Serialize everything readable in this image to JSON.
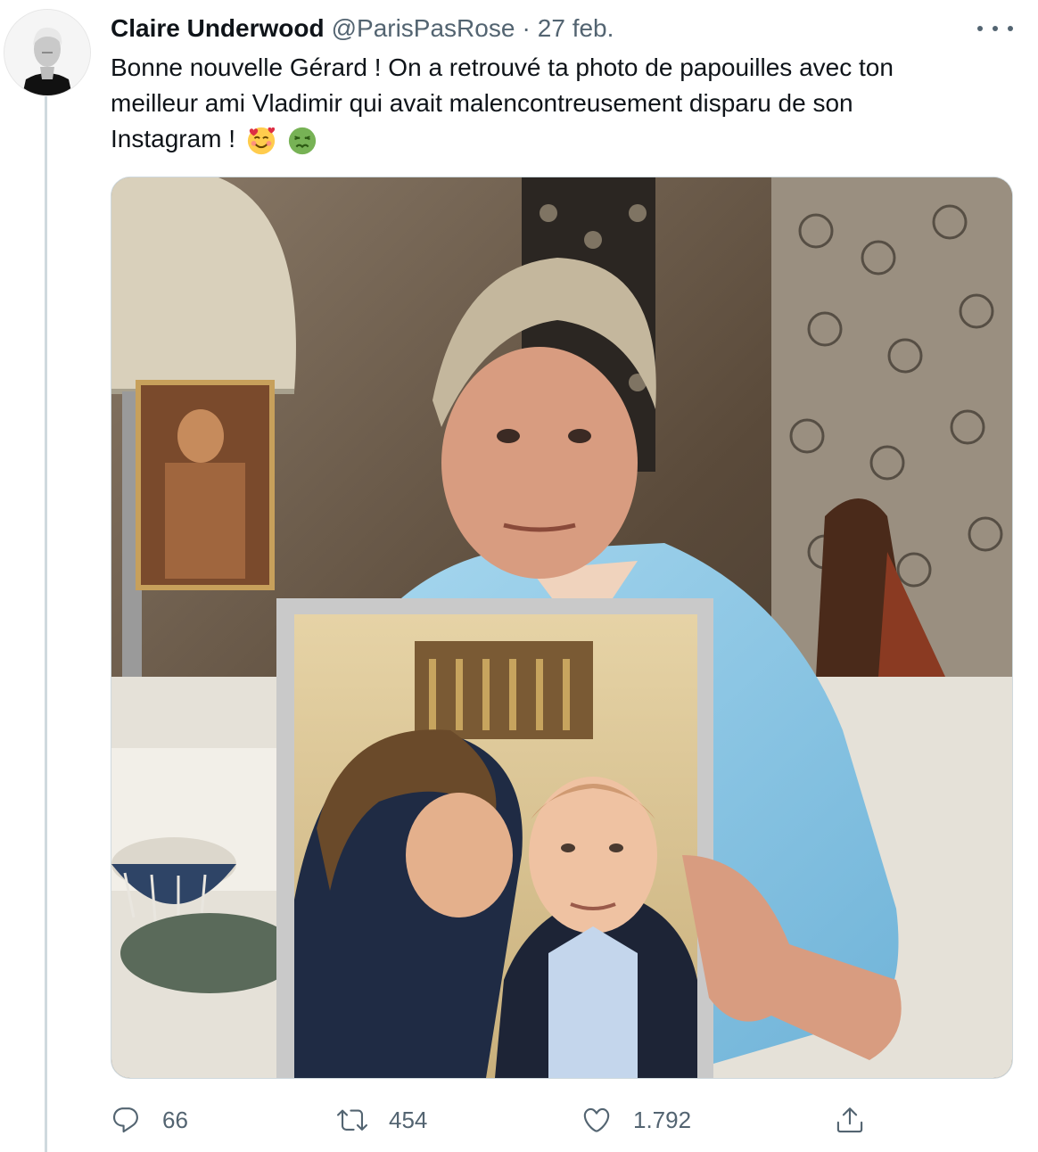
{
  "tweet": {
    "author_name": "Claire Underwood",
    "handle": "@ParisPasRose",
    "separator": "·",
    "date": "27 feb.",
    "text_line1": "Bonne nouvelle Gérard ! On a retrouvé ta photo de papouilles avec ton",
    "text_line2": "meilleur ami Vladimir qui avait malencontreusement disparu de son",
    "text_line3": "Instagram !",
    "emojis": [
      "smiling-face-with-hearts",
      "nauseated-face"
    ]
  },
  "media": {
    "description_icon": "photo",
    "colors": {
      "shirt": "#8ec9e6",
      "frame": "#d4d4d4",
      "background": "#6b5a48"
    }
  },
  "actions": {
    "reply_count": "66",
    "retweet_count": "454",
    "like_count": "1.792",
    "icons": [
      "reply-icon",
      "retweet-icon",
      "like-icon",
      "share-icon"
    ]
  },
  "colors": {
    "text": "#0f1419",
    "secondary": "#536471",
    "border": "#cfd9de"
  }
}
